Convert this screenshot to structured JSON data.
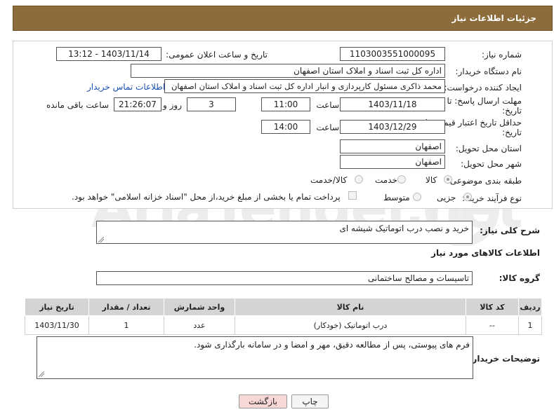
{
  "header": {
    "title": "جزئیات اطلاعات نیاز"
  },
  "fields": {
    "need_number_label": "شماره نیاز:",
    "need_number": "1103003551000095",
    "announce_label": "تاریخ و ساعت اعلان عمومی:",
    "announce_value": "1403/11/14 - 13:12",
    "buyer_org_label": "نام دستگاه خریدار:",
    "buyer_org": "اداره کل ثبت اسناد و املاک استان اصفهان",
    "creator_label": "ایجاد کننده درخواست:",
    "creator": "محمد ذاکری مسئول کارپردازی و انبار اداره کل ثبت اسناد و املاک استان اصفهان",
    "contact_link": "اطلاعات تماس خریدار",
    "reply_deadline_label_1": "مهلت ارسال پاسخ: تا",
    "reply_deadline_label_2": "تاریخ:",
    "reply_date": "1403/11/18",
    "time_label": "ساعت",
    "reply_time": "11:00",
    "days_count": "3",
    "days_label": "روز و",
    "remaining_time": "21:26:07",
    "remaining_label": "ساعت باقی مانده",
    "price_validity_label_1": "حداقل تاریخ اعتبار قیمت: تا",
    "price_validity_label_2": "تاریخ:",
    "price_date": "1403/12/29",
    "price_time_label": "ساعت",
    "price_time": "14:00",
    "province_label": "استان محل تحویل:",
    "province": "اصفهان",
    "city_label": "شهر محل تحویل:",
    "city": "اصفهان",
    "category_label": "طبقه بندی موضوعی:",
    "category_options": [
      "کالا",
      "خدمت",
      "کالا/خدمت"
    ],
    "category_selected": "کالا",
    "process_label": "نوع فرآیند خرید :",
    "process_options": [
      "جزیی",
      "متوسط"
    ],
    "process_selected": "جزیی",
    "payment_note": "پرداخت تمام یا بخشی از مبلغ خرید،از محل \"اسناد خزانه اسلامی\" خواهد بود."
  },
  "description": {
    "label": "شرح کلی نیاز:",
    "value": "خرید و نصب درب اتوماتیک شیشه ای"
  },
  "goods_section": {
    "title": "اطلاعات کالاهای مورد نیاز",
    "group_label": "گروه کالا:",
    "group_value": "تاسیسات و مصالح ساختمانی"
  },
  "table": {
    "headers": [
      "ردیف",
      "کد کالا",
      "نام کالا",
      "واحد شمارش",
      "تعداد / مقدار",
      "تاریخ نیاز"
    ],
    "rows": [
      [
        "1",
        "--",
        "درب اتوماتیک (خودکار)",
        "عدد",
        "1",
        "1403/11/30"
      ]
    ]
  },
  "buyer_notes": {
    "label": "توضیحات خریدار:",
    "value": "فرم های پیوستی، پس از مطالعه دقیق، مهر و امضا و در سامانه بارگذاری شود."
  },
  "buttons": {
    "print": "چاپ",
    "back": "بازگشت"
  },
  "watermark": {
    "text": "AriaTender.net"
  },
  "colors": {
    "header_bg": "#8b6c3a",
    "back_button_bg": "#f8d7d7",
    "link": "#1a4fb0",
    "table_header_bg": "#d4d4d4"
  }
}
